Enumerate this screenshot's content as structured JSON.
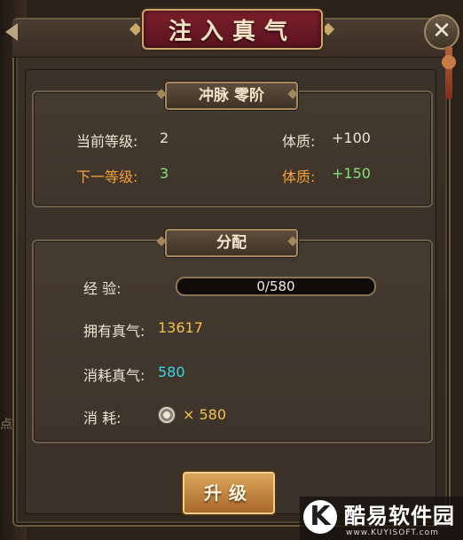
{
  "window": {
    "title": "注入真气",
    "close_glyph": "✕"
  },
  "background": {
    "stub_text": "点"
  },
  "level_panel": {
    "tag": "冲脉  零阶",
    "current_label": "当前等级:",
    "current_value": "2",
    "current_stat_label": "体质:",
    "current_stat_value": "+100",
    "next_label": "下一等级:",
    "next_value": "3",
    "next_stat_label": "体质:",
    "next_stat_value": "+150"
  },
  "allocate_panel": {
    "tag": "分配",
    "exp_label": "经    验:",
    "exp_text": "0/580",
    "exp_progress": 0,
    "owned_label": "拥有真气:",
    "owned_value": "13617",
    "consume_label": "消耗真气:",
    "consume_value": "580",
    "cost_label": "消    耗:",
    "cost_value": "× 580",
    "cost_icon": "coin-icon"
  },
  "upgrade_button": {
    "label": "升级"
  },
  "watermark": {
    "logo": "K",
    "text": "酷易软件园",
    "sub": "www.KUYISOFT.com"
  },
  "colors": {
    "label_white": "#ece3d3",
    "next_orange": "#f3a23a",
    "value_green": "#7fe075",
    "value_yellow": "#f2c14a",
    "value_cyan": "#38d6e6",
    "title_red": "#7b1f2b",
    "gold_border": "#c9a86a"
  }
}
